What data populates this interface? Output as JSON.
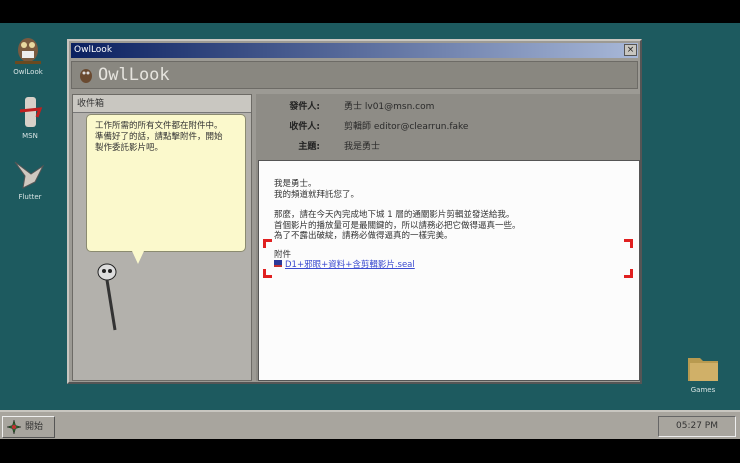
{
  "desktop": {
    "icons": [
      {
        "label": "OwlLook"
      },
      {
        "label": "MSN"
      },
      {
        "label": "Flutter"
      },
      {
        "label": "Games"
      }
    ]
  },
  "window": {
    "title": "OwlLook",
    "brand": "OwlLook",
    "close": "×",
    "inbox_label": "收件箱",
    "tooltip": [
      "工作所需的所有文件都在附件中。",
      "準備好了的話，請點擊附件，開始",
      "製作委託影片吧。"
    ],
    "fields": [
      {
        "key": "發件人:",
        "value": "勇士 lv01@msn.com"
      },
      {
        "key": "收件人:",
        "value": "剪輯師 editor@clearrun.fake"
      },
      {
        "key": "主題:",
        "value": "我是勇士"
      }
    ],
    "body": [
      "我是勇士。",
      "我的頻道就拜託您了。",
      "",
      "那麼，請在今天內完成地下城 1 層的通關影片剪輯並發送給我。",
      "首個影片的播放量可是最關鍵的，所以請務必把它做得逼真一些。",
      "為了不露出破綻，請務必做得逼真的一樣完美。"
    ],
    "attachment_label": "附件",
    "attachment_file": "D1+邪眼+資料+含剪輯影片.seal"
  },
  "taskbar": {
    "start": "開始",
    "clock": "05:27 PM"
  }
}
